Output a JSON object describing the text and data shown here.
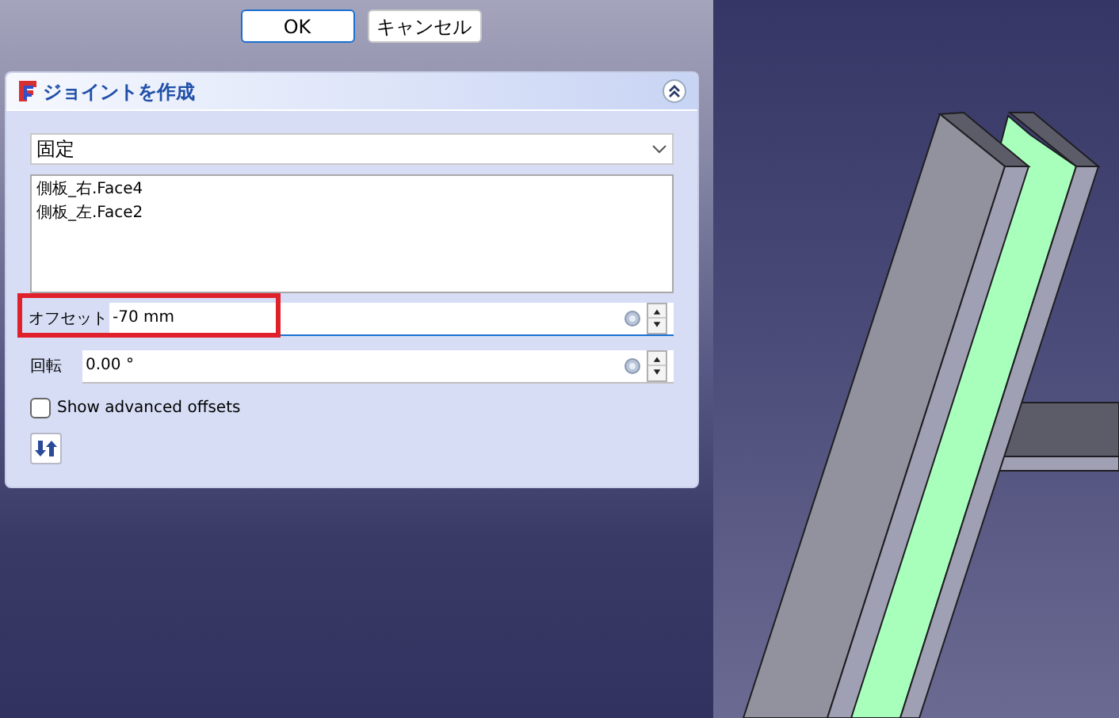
{
  "dialog_buttons": [
    {
      "label": "OK",
      "default": true
    },
    {
      "label": "キャンセル",
      "default": false
    }
  ],
  "task_panel": {
    "title": "ジョイントを作成",
    "joint_type": {
      "value": "固定"
    },
    "references": [
      "側板_右.Face4",
      "側板_左.Face2"
    ],
    "fields": [
      {
        "label": "オフセット",
        "value": "-70 mm",
        "highlighted": true
      },
      {
        "label": "回転",
        "value": "0.00 °",
        "highlighted": false
      }
    ],
    "advanced_offsets": {
      "label": "Show advanced offsets",
      "checked": false
    }
  }
}
